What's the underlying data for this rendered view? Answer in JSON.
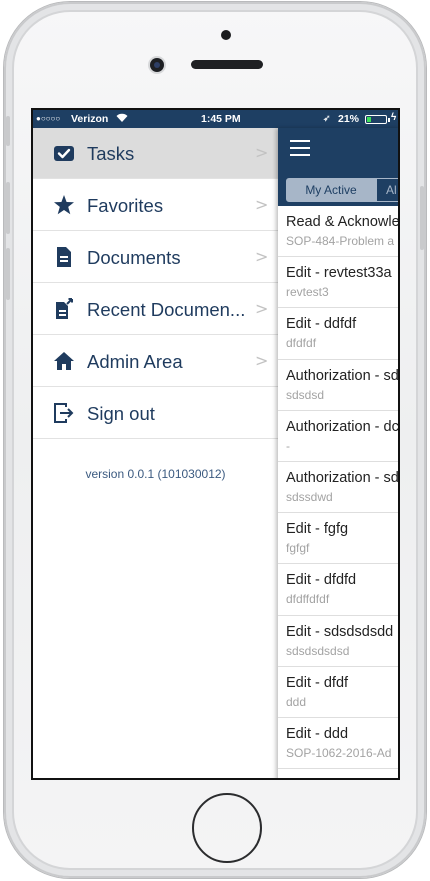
{
  "status_bar": {
    "signal": "●○○○○",
    "carrier": "Verizon",
    "time": "1:45 PM",
    "location_icon": "location-arrow-icon",
    "battery_percent": "21%",
    "battery_level": 0.21,
    "battery_color": "#3ce05a"
  },
  "side_menu": {
    "items": [
      {
        "label": "Tasks",
        "icon": "checkbox-icon"
      },
      {
        "label": "Favorites",
        "icon": "star-icon"
      },
      {
        "label": "Documents",
        "icon": "document-icon"
      },
      {
        "label": "Recent Documen...",
        "icon": "recent-document-icon"
      },
      {
        "label": "Admin Area",
        "icon": "home-icon"
      },
      {
        "label": "Sign out",
        "icon": "sign-out-icon"
      }
    ],
    "chevron": ">",
    "version": "version 0.0.1 (101030012)"
  },
  "main": {
    "tabs": [
      {
        "label": "My Active"
      },
      {
        "label": "Al"
      }
    ],
    "tasks": [
      {
        "title": "Read & Acknowled",
        "subtitle": "SOP-484-Problem a"
      },
      {
        "title": "Edit - revtest33a",
        "subtitle": "revtest3"
      },
      {
        "title": "Edit - ddfdf",
        "subtitle": "dfdfdf"
      },
      {
        "title": "Authorization - sd",
        "subtitle": "sdsdsd"
      },
      {
        "title": "Authorization - dc",
        "subtitle": "-"
      },
      {
        "title": "Authorization - sd",
        "subtitle": "sdssdwd"
      },
      {
        "title": "Edit - fgfg",
        "subtitle": "fgfgf"
      },
      {
        "title": "Edit - dfdfd",
        "subtitle": "dfdffdfdf"
      },
      {
        "title": "Edit - sdsdsdsdd",
        "subtitle": "sdsdsdsdsd"
      },
      {
        "title": "Edit - dfdf",
        "subtitle": "ddd"
      },
      {
        "title": "Edit - ddd",
        "subtitle": "SOP-1062-2016-Ad"
      }
    ]
  },
  "colors": {
    "nav_bar": "#1e3f63",
    "menu_text": "#1f3b5e",
    "active_row": "#dcdcdc",
    "segment_active": "#a7b6c8"
  }
}
